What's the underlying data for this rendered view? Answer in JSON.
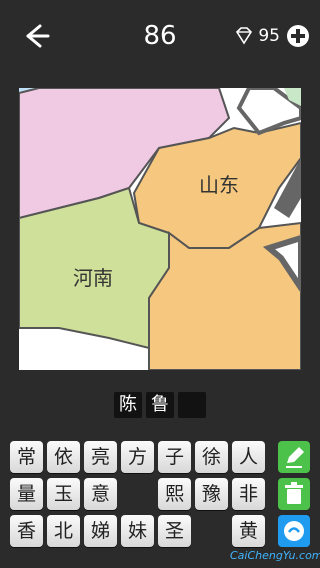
{
  "header": {
    "level": "86",
    "coins": "95"
  },
  "map": {
    "labels": [
      "山东",
      "河南"
    ]
  },
  "answer": {
    "slots": [
      "陈",
      "鲁",
      ""
    ]
  },
  "keyboard": {
    "rows": [
      [
        "常",
        "依",
        "亮",
        "方",
        "子",
        "徐",
        "人"
      ],
      [
        "量",
        "玉",
        "意",
        "",
        "熙",
        "豫",
        "非"
      ],
      [
        "香",
        "北",
        "娣",
        "妹",
        "圣",
        "",
        "黄"
      ]
    ]
  },
  "actions": {
    "edit": "pencil-icon",
    "delete": "trash-icon",
    "share": "share-icon"
  },
  "watermark": "CaiChengYu.com",
  "colors": {
    "background": "#2b2b2b",
    "shandong": "#f6c77f",
    "henan": "#cfe09a",
    "hebei": "#f0c9e3",
    "action_green": "#4cc24a",
    "action_blue": "#1f9bf0"
  }
}
